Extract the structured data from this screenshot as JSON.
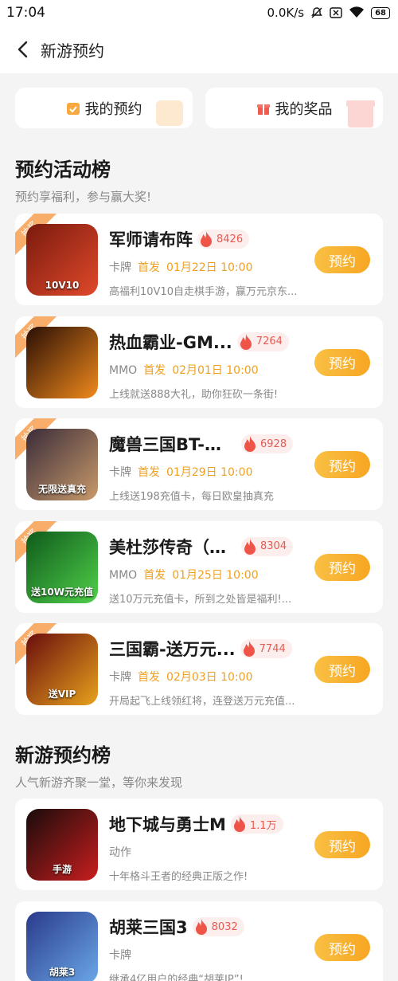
{
  "status": {
    "time": "17:04",
    "speed": "0.0K/s",
    "battery": "68"
  },
  "nav": {
    "title": "新游预约"
  },
  "top_buttons": {
    "my_reservations": "我的预约",
    "my_prizes": "我的奖品"
  },
  "activity": {
    "title": "预约活动榜",
    "subtitle": "预约享福利，参与赢大奖!",
    "badge": "抽奖",
    "items": [
      {
        "name": "军师请布阵",
        "hot": "8426",
        "category": "卡牌",
        "first": "首发",
        "date": "01月22日 10:00",
        "desc": "高福利10V10自走棋手游，赢万元京东...",
        "button": "预约",
        "icon_label": "10V10",
        "icon_colors": [
          "#7a1a0e",
          "#e0492a"
        ]
      },
      {
        "name": "热血霸业-GM...",
        "hot": "7264",
        "category": "MMO",
        "first": "首发",
        "date": "02月01日 10:00",
        "desc": "上线就送888大礼，助你狂砍一条街!",
        "button": "预约",
        "icon_label": "",
        "icon_colors": [
          "#2a0e05",
          "#f08a1c"
        ]
      },
      {
        "name": "魔兽三国BT-无...",
        "hot": "6928",
        "category": "卡牌",
        "first": "首发",
        "date": "01月29日 10:00",
        "desc": "上线送198充值卡，每日欧皇抽真充",
        "button": "预约",
        "icon_label": "无限送真充",
        "icon_colors": [
          "#3a2c3a",
          "#c99a6a"
        ]
      },
      {
        "name": "美杜莎传奇（█...",
        "hot": "8304",
        "category": "MMO",
        "first": "首发",
        "date": "01月25日 10:00",
        "desc": "送10万元充值卡，所到之处皆是福利!...",
        "button": "预约",
        "icon_label": "送10W元充值",
        "icon_colors": [
          "#0f5a1a",
          "#4fd04a"
        ]
      },
      {
        "name": "三国霸-送万元...",
        "hot": "7744",
        "category": "卡牌",
        "first": "首发",
        "date": "02月03日 10:00",
        "desc": "开局起飞上线领红将，连登送万元充值...",
        "button": "预约",
        "icon_label": "送VIP",
        "icon_colors": [
          "#6a0d0d",
          "#e8a21c"
        ]
      }
    ]
  },
  "new_games": {
    "title": "新游预约榜",
    "subtitle": "人气新游齐聚一堂，等你来发现",
    "items": [
      {
        "name": "地下城与勇士M",
        "hot": "1.1万",
        "category": "动作",
        "desc": "十年格斗王者的经典正版之作!",
        "button": "预约",
        "icon_label": "手游",
        "icon_colors": [
          "#1a0b0b",
          "#c81e1e"
        ]
      },
      {
        "name": "胡莱三国3",
        "hot": "8032",
        "category": "卡牌",
        "desc": "继承4亿用户的经典“胡莱IP”!",
        "button": "预约",
        "icon_label": "胡莱3",
        "icon_colors": [
          "#2a3a8a",
          "#6aa8e8"
        ]
      }
    ]
  },
  "colors": {
    "accent": "#f7a623",
    "hot_text": "#e85a50",
    "date": "#f0a020"
  }
}
